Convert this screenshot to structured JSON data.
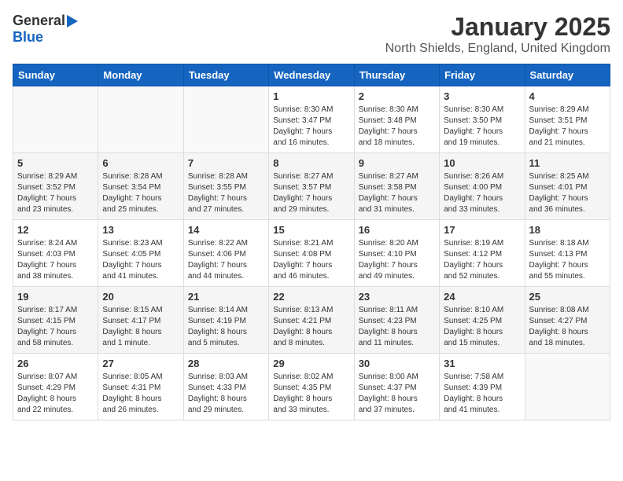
{
  "header": {
    "logo_general": "General",
    "logo_blue": "Blue",
    "month_title": "January 2025",
    "location": "North Shields, England, United Kingdom"
  },
  "days_of_week": [
    "Sunday",
    "Monday",
    "Tuesday",
    "Wednesday",
    "Thursday",
    "Friday",
    "Saturday"
  ],
  "weeks": [
    {
      "shaded": false,
      "days": [
        {
          "num": "",
          "info": ""
        },
        {
          "num": "",
          "info": ""
        },
        {
          "num": "",
          "info": ""
        },
        {
          "num": "1",
          "info": "Sunrise: 8:30 AM\nSunset: 3:47 PM\nDaylight: 7 hours\nand 16 minutes."
        },
        {
          "num": "2",
          "info": "Sunrise: 8:30 AM\nSunset: 3:48 PM\nDaylight: 7 hours\nand 18 minutes."
        },
        {
          "num": "3",
          "info": "Sunrise: 8:30 AM\nSunset: 3:50 PM\nDaylight: 7 hours\nand 19 minutes."
        },
        {
          "num": "4",
          "info": "Sunrise: 8:29 AM\nSunset: 3:51 PM\nDaylight: 7 hours\nand 21 minutes."
        }
      ]
    },
    {
      "shaded": true,
      "days": [
        {
          "num": "5",
          "info": "Sunrise: 8:29 AM\nSunset: 3:52 PM\nDaylight: 7 hours\nand 23 minutes."
        },
        {
          "num": "6",
          "info": "Sunrise: 8:28 AM\nSunset: 3:54 PM\nDaylight: 7 hours\nand 25 minutes."
        },
        {
          "num": "7",
          "info": "Sunrise: 8:28 AM\nSunset: 3:55 PM\nDaylight: 7 hours\nand 27 minutes."
        },
        {
          "num": "8",
          "info": "Sunrise: 8:27 AM\nSunset: 3:57 PM\nDaylight: 7 hours\nand 29 minutes."
        },
        {
          "num": "9",
          "info": "Sunrise: 8:27 AM\nSunset: 3:58 PM\nDaylight: 7 hours\nand 31 minutes."
        },
        {
          "num": "10",
          "info": "Sunrise: 8:26 AM\nSunset: 4:00 PM\nDaylight: 7 hours\nand 33 minutes."
        },
        {
          "num": "11",
          "info": "Sunrise: 8:25 AM\nSunset: 4:01 PM\nDaylight: 7 hours\nand 36 minutes."
        }
      ]
    },
    {
      "shaded": false,
      "days": [
        {
          "num": "12",
          "info": "Sunrise: 8:24 AM\nSunset: 4:03 PM\nDaylight: 7 hours\nand 38 minutes."
        },
        {
          "num": "13",
          "info": "Sunrise: 8:23 AM\nSunset: 4:05 PM\nDaylight: 7 hours\nand 41 minutes."
        },
        {
          "num": "14",
          "info": "Sunrise: 8:22 AM\nSunset: 4:06 PM\nDaylight: 7 hours\nand 44 minutes."
        },
        {
          "num": "15",
          "info": "Sunrise: 8:21 AM\nSunset: 4:08 PM\nDaylight: 7 hours\nand 46 minutes."
        },
        {
          "num": "16",
          "info": "Sunrise: 8:20 AM\nSunset: 4:10 PM\nDaylight: 7 hours\nand 49 minutes."
        },
        {
          "num": "17",
          "info": "Sunrise: 8:19 AM\nSunset: 4:12 PM\nDaylight: 7 hours\nand 52 minutes."
        },
        {
          "num": "18",
          "info": "Sunrise: 8:18 AM\nSunset: 4:13 PM\nDaylight: 7 hours\nand 55 minutes."
        }
      ]
    },
    {
      "shaded": true,
      "days": [
        {
          "num": "19",
          "info": "Sunrise: 8:17 AM\nSunset: 4:15 PM\nDaylight: 7 hours\nand 58 minutes."
        },
        {
          "num": "20",
          "info": "Sunrise: 8:15 AM\nSunset: 4:17 PM\nDaylight: 8 hours\nand 1 minute."
        },
        {
          "num": "21",
          "info": "Sunrise: 8:14 AM\nSunset: 4:19 PM\nDaylight: 8 hours\nand 5 minutes."
        },
        {
          "num": "22",
          "info": "Sunrise: 8:13 AM\nSunset: 4:21 PM\nDaylight: 8 hours\nand 8 minutes."
        },
        {
          "num": "23",
          "info": "Sunrise: 8:11 AM\nSunset: 4:23 PM\nDaylight: 8 hours\nand 11 minutes."
        },
        {
          "num": "24",
          "info": "Sunrise: 8:10 AM\nSunset: 4:25 PM\nDaylight: 8 hours\nand 15 minutes."
        },
        {
          "num": "25",
          "info": "Sunrise: 8:08 AM\nSunset: 4:27 PM\nDaylight: 8 hours\nand 18 minutes."
        }
      ]
    },
    {
      "shaded": false,
      "days": [
        {
          "num": "26",
          "info": "Sunrise: 8:07 AM\nSunset: 4:29 PM\nDaylight: 8 hours\nand 22 minutes."
        },
        {
          "num": "27",
          "info": "Sunrise: 8:05 AM\nSunset: 4:31 PM\nDaylight: 8 hours\nand 26 minutes."
        },
        {
          "num": "28",
          "info": "Sunrise: 8:03 AM\nSunset: 4:33 PM\nDaylight: 8 hours\nand 29 minutes."
        },
        {
          "num": "29",
          "info": "Sunrise: 8:02 AM\nSunset: 4:35 PM\nDaylight: 8 hours\nand 33 minutes."
        },
        {
          "num": "30",
          "info": "Sunrise: 8:00 AM\nSunset: 4:37 PM\nDaylight: 8 hours\nand 37 minutes."
        },
        {
          "num": "31",
          "info": "Sunrise: 7:58 AM\nSunset: 4:39 PM\nDaylight: 8 hours\nand 41 minutes."
        },
        {
          "num": "",
          "info": ""
        }
      ]
    }
  ]
}
